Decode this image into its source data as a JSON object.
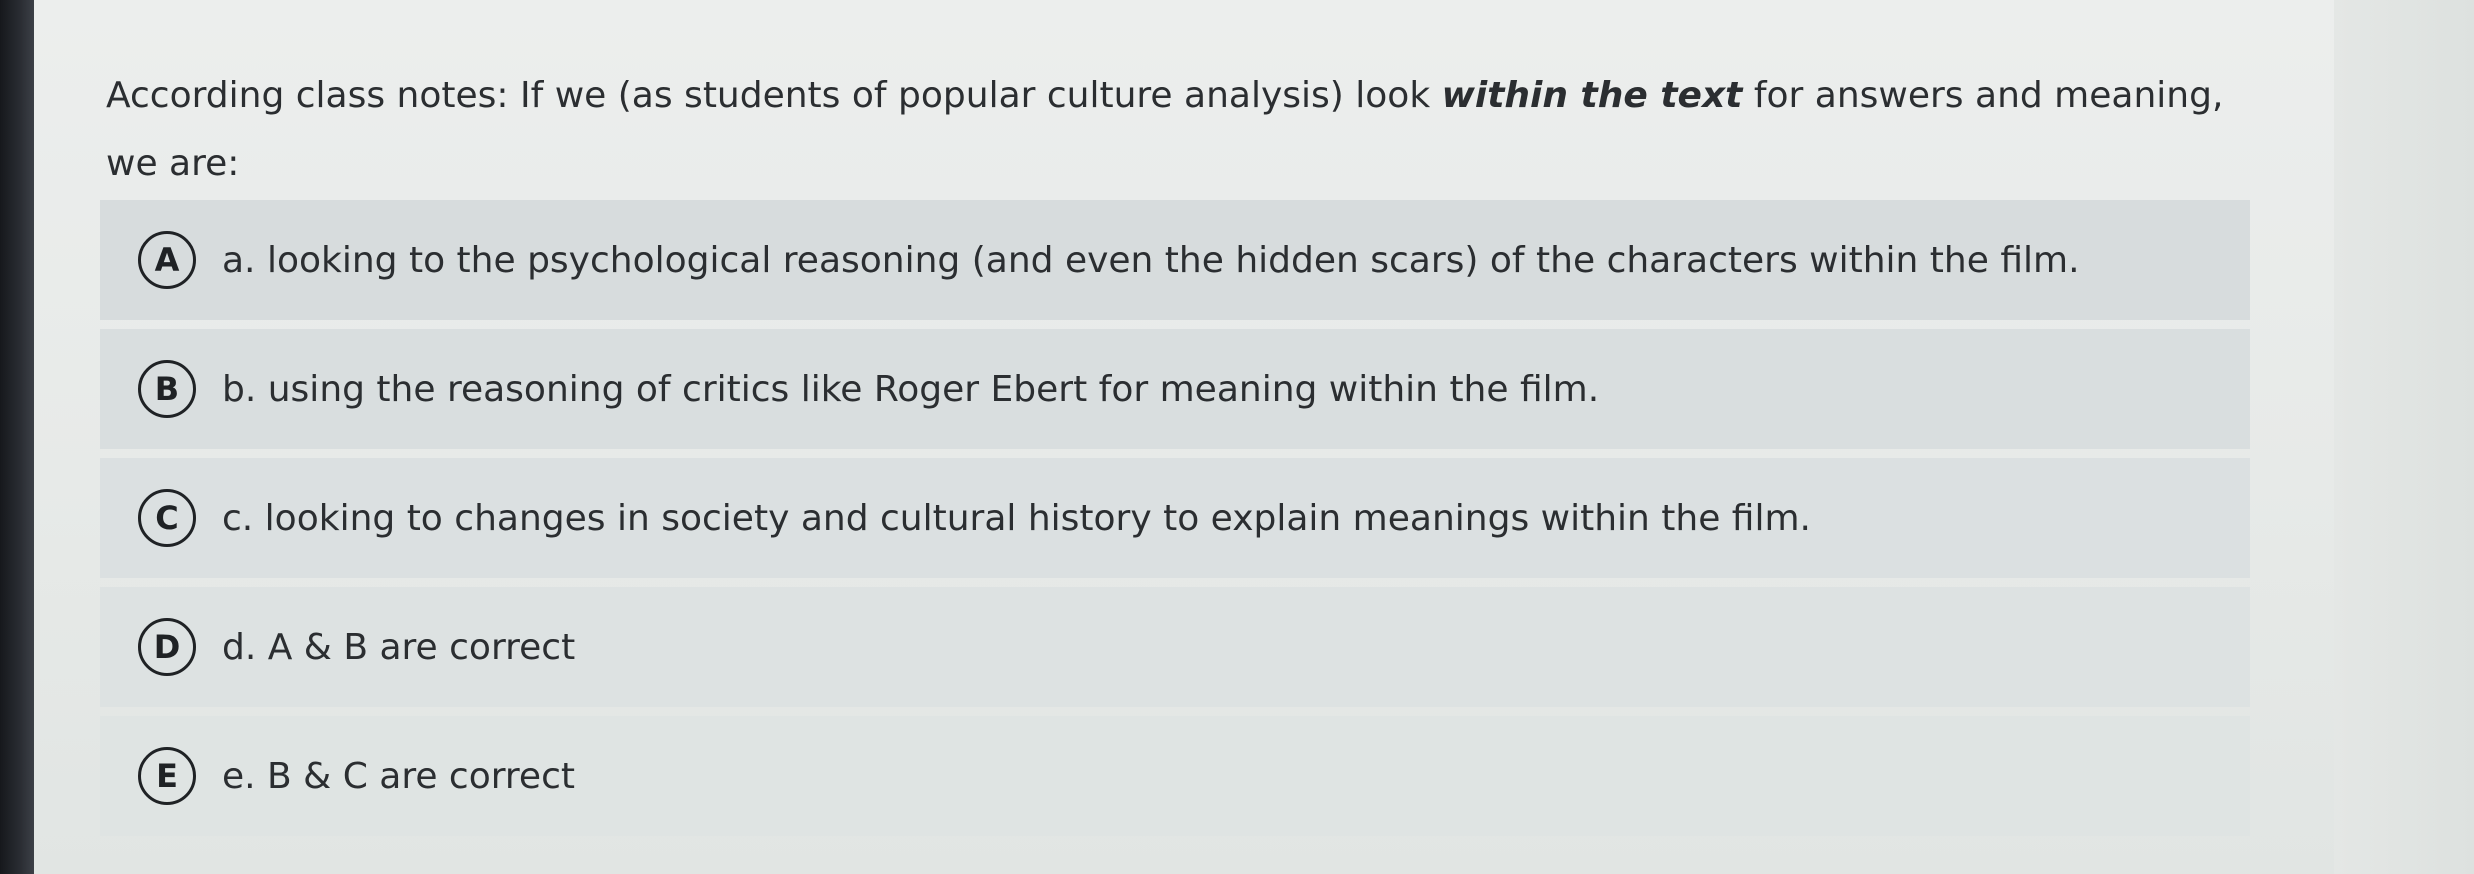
{
  "question": {
    "text_before": "According class notes: If we (as students of popular culture analysis) look ",
    "emphasis": "within the text",
    "text_after": " for answers and meaning, we are:"
  },
  "options": [
    {
      "letter": "A",
      "text": "a. looking to the psychological reasoning (and even the hidden scars) of the characters within the film."
    },
    {
      "letter": "B",
      "text": "b. using the reasoning of critics like Roger Ebert for meaning within the film."
    },
    {
      "letter": "C",
      "text": "c. looking to changes in society and cultural history to explain meanings within the film."
    },
    {
      "letter": "D",
      "text": "d. A & B are correct"
    },
    {
      "letter": "E",
      "text": "e. B & C are correct"
    }
  ],
  "colors": {
    "text": "#2b2e31",
    "option_background": "#d7dcdd",
    "bubble_border": "#1f2225",
    "page_background": "#e7eae8"
  }
}
